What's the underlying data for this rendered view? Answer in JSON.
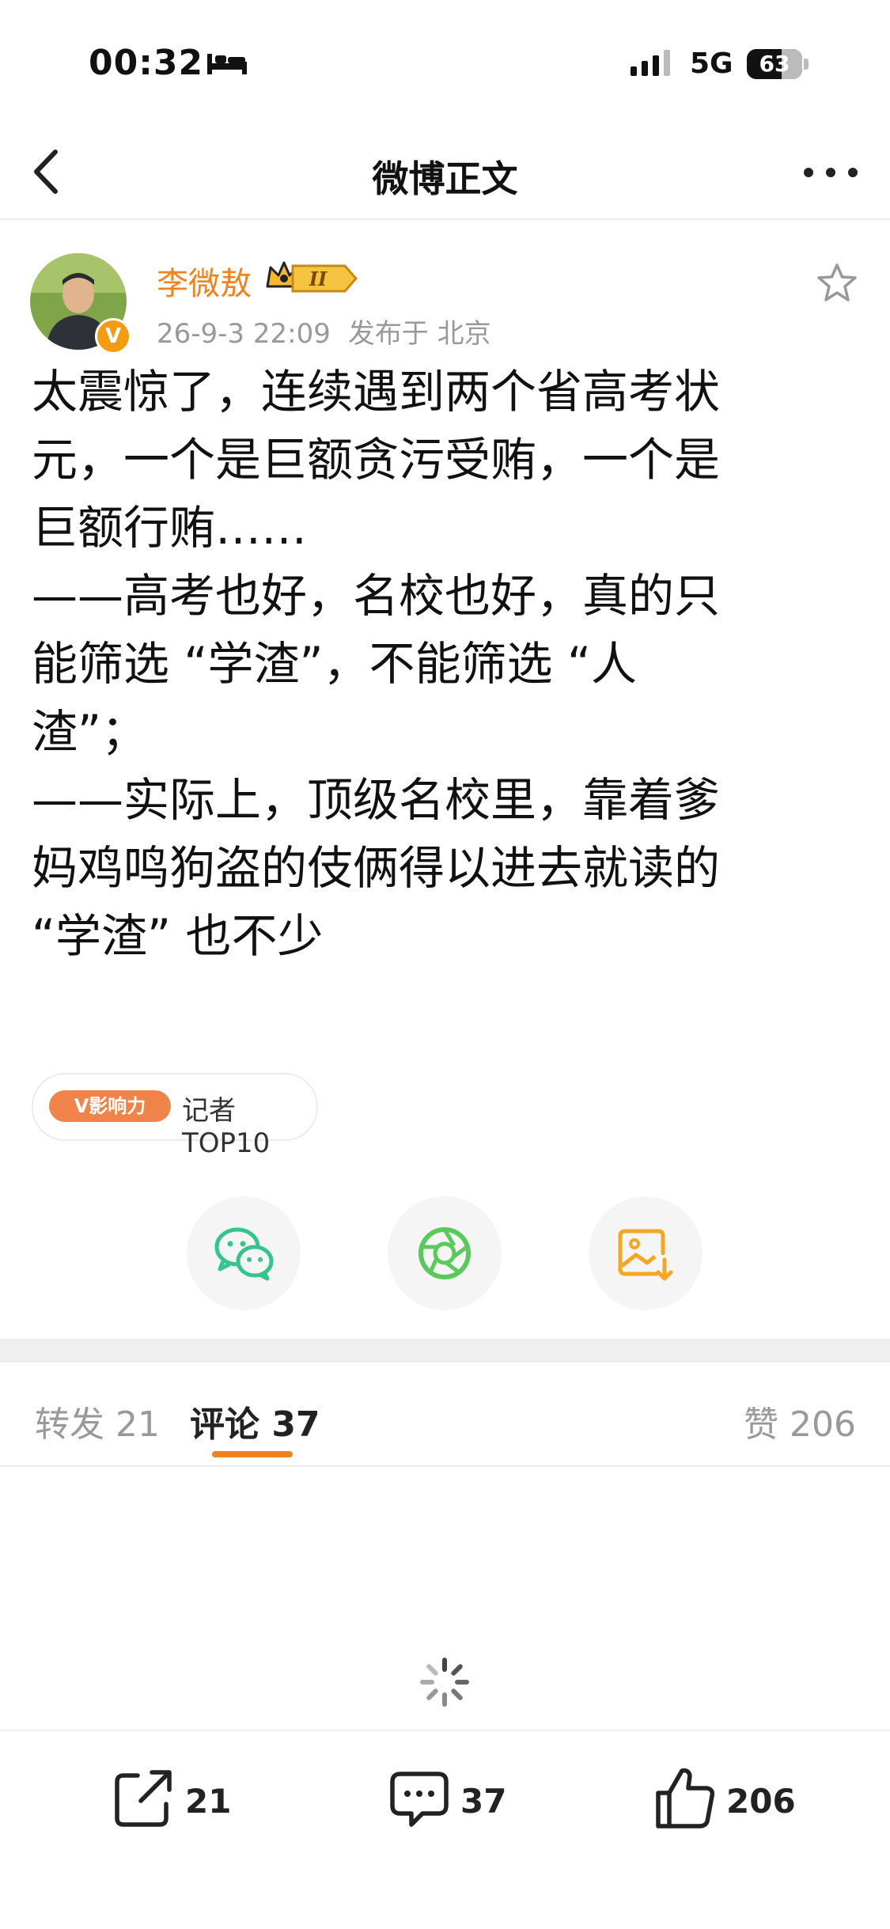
{
  "status_bar": {
    "time": "00:32",
    "network": "5G",
    "battery": "63",
    "icons": [
      "bed-icon",
      "signal-icon",
      "battery-icon"
    ]
  },
  "nav": {
    "title": "微博正文",
    "icons": [
      "back-icon",
      "more-icon"
    ]
  },
  "post": {
    "author": "李微敖",
    "verified_mark": "V",
    "level": "II",
    "date": "26-9-3 22:09",
    "location": "发布于 北京",
    "body_lines": [
      "太震惊了，连续遇到两个省高考状",
      "元，一个是巨额贪污受贿，一个是",
      "巨额行贿……",
      "——高考也好，名校也好，真的只",
      "能筛选 “学渣”，不能筛选 “人",
      "渣”；",
      "——实际上，顶级名校里，靠着爹",
      "妈鸡鸣狗盗的伎俩得以进去就读的",
      "“学渣” 也不少"
    ],
    "influence": {
      "pill": "V影响力",
      "text": "记者TOP10"
    },
    "share_icons": [
      "wechat-icon",
      "moments-icon",
      "save-image-icon"
    ]
  },
  "tabs": {
    "repost": "转发 21",
    "comment": "评论 37",
    "like": "赞 206"
  },
  "toolbar": {
    "repost_count": "21",
    "comment_count": "37",
    "like_count": "206"
  },
  "colors": {
    "accent": "#f0831e",
    "wechat": "#35c48c",
    "moments": "#5bc85b",
    "save": "#f5a623"
  }
}
